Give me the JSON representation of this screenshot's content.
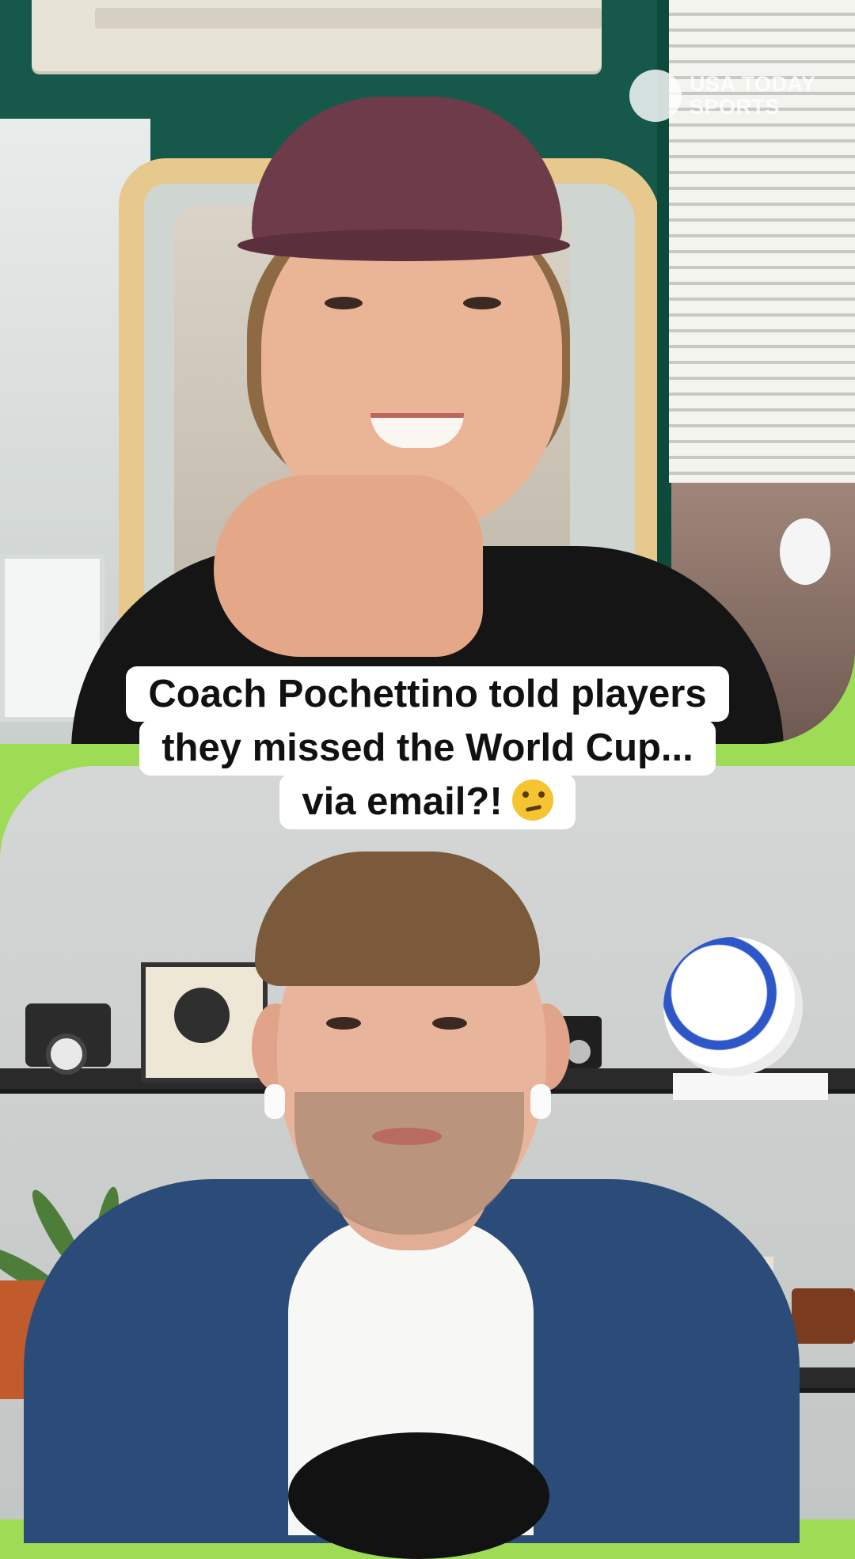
{
  "brand": {
    "logo_line1": "USA TODAY",
    "logo_line2": "SPORTS"
  },
  "caption": {
    "line1": "Coach Pochettino told players",
    "line2": "they missed the World Cup...",
    "line3": "via email?!",
    "emoji": "thinking-face"
  },
  "colors": {
    "accent_green": "#9fdc55",
    "caption_bg": "#ffffff",
    "caption_text": "#111111"
  }
}
